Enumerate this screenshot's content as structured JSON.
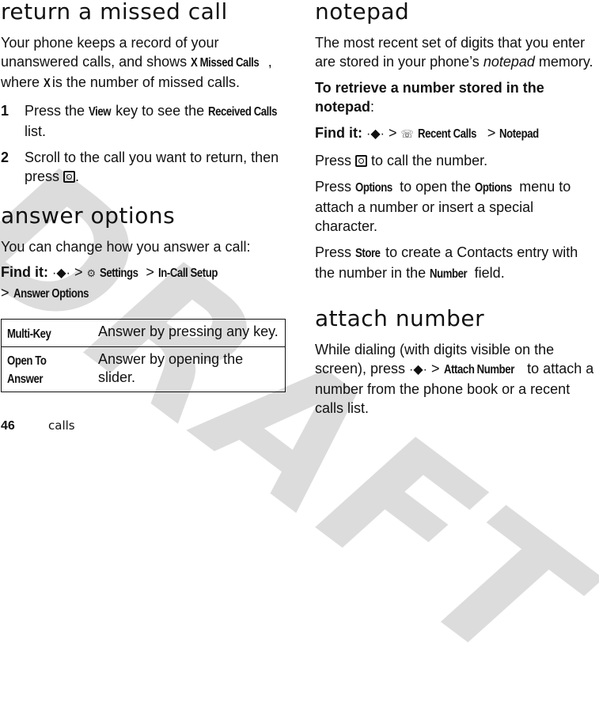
{
  "watermark": "DRAFT",
  "left": {
    "missed": {
      "title": "return a missed call",
      "intro_1": "Your phone keeps a record of your unanswered calls, and shows ",
      "intro_key": "X Missed Calls",
      "intro_2": ", where ",
      "intro_x": "X",
      "intro_3": " is the number of missed calls.",
      "steps": [
        {
          "num": "1",
          "t1": "Press the ",
          "k1": "View",
          "t2": " key to see the ",
          "k2": "Received Calls",
          "t3": " list."
        },
        {
          "num": "2",
          "t1": "Scroll to the call you want to return, then press ",
          "t3": "."
        }
      ]
    },
    "answer": {
      "title": "answer options",
      "intro": "You can change how you answer a call:",
      "find_label": "Find it:",
      "path": [
        ">",
        "Settings",
        ">",
        "In-Call Setup",
        ">",
        "Answer Options"
      ],
      "settings_icon": "settings-icon",
      "table": [
        {
          "option": "Multi-Key",
          "desc": "Answer by pressing any key."
        },
        {
          "option": "Open To Answer",
          "desc": "Answer by opening the slider."
        }
      ]
    }
  },
  "right": {
    "notepad": {
      "title": "notepad",
      "intro_1": "The most recent set of digits that you enter are stored in your phone’s ",
      "intro_em": "notepad",
      "intro_2": " memory.",
      "retrieve": "To retrieve a number stored in the notepad",
      "retrieve_colon": ":",
      "find_label": "Find it:",
      "path": [
        ">",
        "Recent Calls",
        ">",
        "Notepad"
      ],
      "recent_icon": "recent-calls-icon",
      "press_call_1": "Press ",
      "press_call_2": " to call the number.",
      "options_1": "Press ",
      "options_k1": "Options",
      "options_2": " to open the ",
      "options_k2": "Options",
      "options_3": " menu to attach a number or insert a special character.",
      "store_1": "Press ",
      "store_k": "Store",
      "store_2": " to create a Contacts entry with the number in the ",
      "store_k2": "Number",
      "store_3": " field."
    },
    "attach": {
      "title": "attach number",
      "t1": "While dialing (with digits visible on the screen), press ",
      "sep": ">",
      "k": "Attach Number",
      "t2": " to attach a number from the phone book or a recent calls list."
    }
  },
  "footer": {
    "page": "46",
    "section": "calls"
  }
}
